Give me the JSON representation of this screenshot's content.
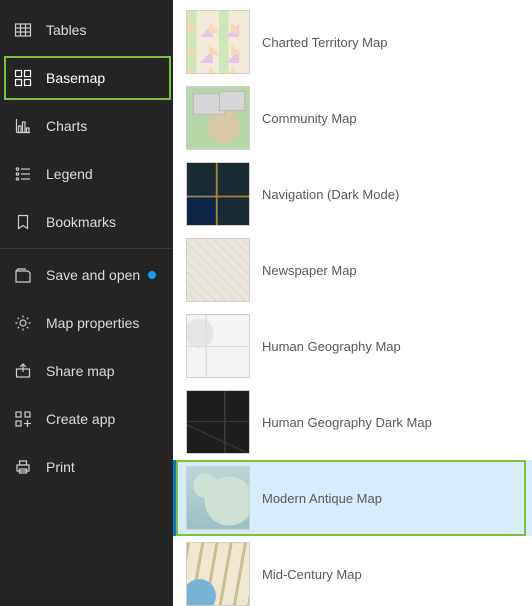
{
  "sidebar": {
    "items": [
      {
        "id": "tables",
        "label": "Tables",
        "icon": "table-icon"
      },
      {
        "id": "basemap",
        "label": "Basemap",
        "icon": "basemap-icon",
        "active": true,
        "highlighted": true
      },
      {
        "id": "charts",
        "label": "Charts",
        "icon": "charts-icon"
      },
      {
        "id": "legend",
        "label": "Legend",
        "icon": "legend-icon"
      },
      {
        "id": "bookmarks",
        "label": "Bookmarks",
        "icon": "bookmark-icon"
      }
    ],
    "items2": [
      {
        "id": "save",
        "label": "Save and open",
        "icon": "save-icon",
        "unsaved_dot": true
      },
      {
        "id": "mapprops",
        "label": "Map properties",
        "icon": "gear-icon"
      },
      {
        "id": "share",
        "label": "Share map",
        "icon": "share-icon"
      },
      {
        "id": "createapp",
        "label": "Create app",
        "icon": "create-app-icon"
      },
      {
        "id": "print",
        "label": "Print",
        "icon": "print-icon"
      }
    ]
  },
  "basemaps": [
    {
      "id": "charted",
      "label": "Charted Territory Map"
    },
    {
      "id": "community",
      "label": "Community Map"
    },
    {
      "id": "navdark",
      "label": "Navigation (Dark Mode)"
    },
    {
      "id": "newspaper",
      "label": "Newspaper Map"
    },
    {
      "id": "humangeo",
      "label": "Human Geography Map"
    },
    {
      "id": "humangeodark",
      "label": "Human Geography Dark Map"
    },
    {
      "id": "antique",
      "label": "Modern Antique Map",
      "selected": true,
      "highlighted": true
    },
    {
      "id": "midcentury",
      "label": "Mid-Century Map"
    }
  ]
}
